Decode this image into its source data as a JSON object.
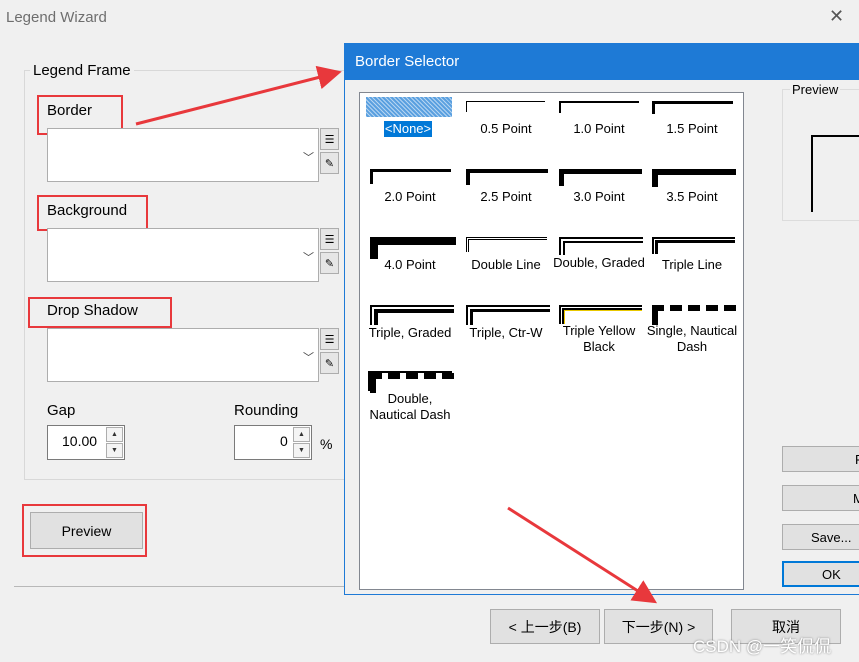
{
  "wizard": {
    "title": "Legend Wizard",
    "close_glyph": "✕",
    "group_caption": "Legend Frame",
    "border_label": "Border",
    "background_label": "Background",
    "drop_shadow_label": "Drop Shadow",
    "gap_label": "Gap",
    "gap_value": "10.00",
    "rounding_label": "Rounding",
    "rounding_value": "0",
    "percent": "%",
    "preview_button": "Preview",
    "back_button": "< 上一步(B)",
    "next_button": "下一步(N) >",
    "cancel_button": "取消"
  },
  "border_selector": {
    "title": "Border Selector",
    "styles": [
      {
        "label": "<None>",
        "selected": true
      },
      {
        "label": "0.5 Point"
      },
      {
        "label": "1.0 Point"
      },
      {
        "label": "1.5 Point"
      },
      {
        "label": "2.0 Point"
      },
      {
        "label": "2.5 Point"
      },
      {
        "label": "3.0 Point"
      },
      {
        "label": "3.5 Point"
      },
      {
        "label": "4.0 Point"
      },
      {
        "label": "Double Line"
      },
      {
        "label": "Double, Graded"
      },
      {
        "label": "Triple Line"
      },
      {
        "label": "Triple, Graded"
      },
      {
        "label": "Triple, Ctr-W"
      },
      {
        "label": "Triple Yellow Black"
      },
      {
        "label": "Single, Nautical Dash"
      },
      {
        "label": "Double, Nautical Dash"
      }
    ],
    "preview_caption": "Preview",
    "button_p": "P",
    "button_m": "M",
    "save_button": "Save...",
    "ok_button": "OK"
  },
  "watermark": "CSDN @一笑侃侃",
  "colors": {
    "annotation_red": "#e8383c",
    "title_blue": "#1e7ad6",
    "selection_blue": "#0078d7"
  }
}
